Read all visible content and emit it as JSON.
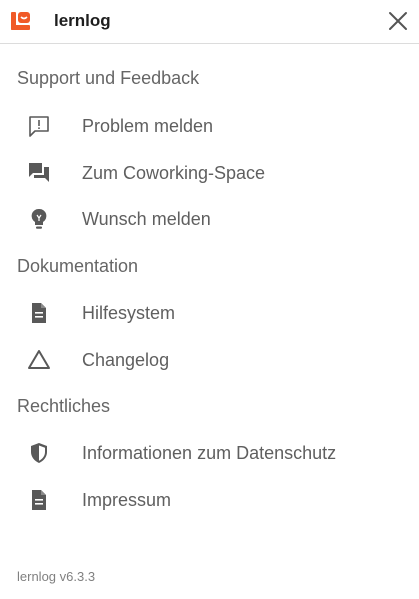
{
  "header": {
    "app_name": "lernlog",
    "logo_icon": "lernlog-logo-icon",
    "close_icon": "close-icon",
    "brand_color": "#f05a28"
  },
  "sections": [
    {
      "title": "Support und Feedback",
      "items": [
        {
          "label": "Problem melden",
          "icon": "speech-bubble-exclamation-icon"
        },
        {
          "label": "Zum Coworking-Space",
          "icon": "chat-bubbles-icon"
        },
        {
          "label": "Wunsch melden",
          "icon": "lightbulb-icon"
        }
      ]
    },
    {
      "title": "Dokumentation",
      "items": [
        {
          "label": "Hilfesystem",
          "icon": "document-icon"
        },
        {
          "label": "Changelog",
          "icon": "triangle-icon"
        }
      ]
    },
    {
      "title": "Rechtliches",
      "items": [
        {
          "label": "Informationen zum Datenschutz",
          "icon": "shield-icon"
        },
        {
          "label": "Impressum",
          "icon": "document-icon"
        }
      ]
    }
  ],
  "footer": {
    "version": "lernlog v6.3.3"
  },
  "colors": {
    "icon": "#595959",
    "text": "#5f5f5f"
  }
}
